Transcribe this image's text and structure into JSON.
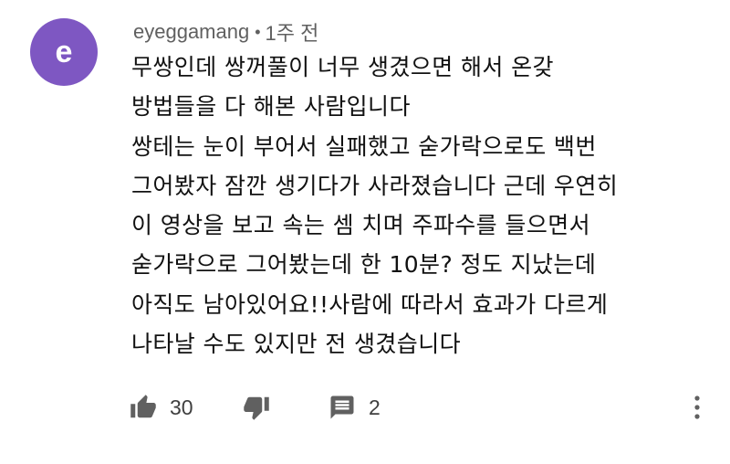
{
  "comment": {
    "avatar_letter": "e",
    "avatar_color": "#7e57c2",
    "author": "eyeggamang",
    "separator": "•",
    "time": "1주 전",
    "lines": [
      "무쌍인데 쌍꺼풀이 너무 생겼으면 해서 온갖",
      "방법들을 다 해본 사람입니다",
      "쌍테는 눈이 부어서 실패했고 숟가락으로도 백번",
      "그어봤자 잠깐 생기다가 사라졌습니다 근데 우연히",
      "이 영상을 보고 속는 셈 치며 주파수를 들으면서",
      "숟가락으로 그어봤는데 한 10분? 정도 지났는데",
      "아직도 남아있어요!!사람에 따라서 효과가 다르게",
      "나타날 수도 있지만 전 생겼습니다"
    ],
    "actions": {
      "like_icon": "thumbs-up-icon",
      "like_count": "30",
      "dislike_icon": "thumbs-down-icon",
      "reply_icon": "comment-icon",
      "reply_count": "2",
      "more_icon": "more-vert-icon"
    }
  }
}
